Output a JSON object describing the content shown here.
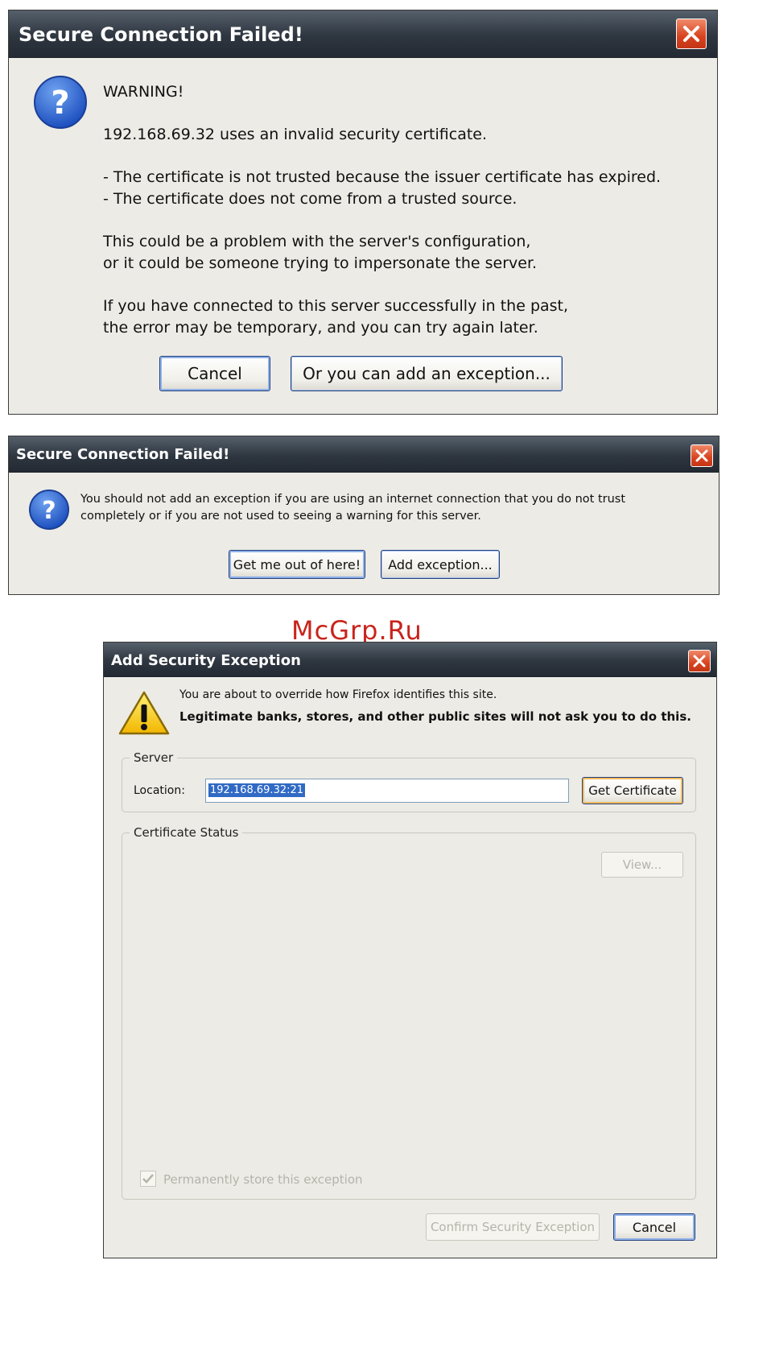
{
  "dialog1": {
    "title": "Secure Connection Failed!",
    "icon": "question-icon",
    "heading": "WARNING!",
    "line_host": "192.168.69.32 uses an invalid security certificate.",
    "bullet1": "- The certificate is not trusted because the issuer certificate has expired.",
    "bullet2": "- The certificate does not come from a trusted source.",
    "para2_line1": "This could be a problem with the server's configuration,",
    "para2_line2": "or it could be someone trying to impersonate the server.",
    "para3_line1": "If you have connected to this server successfully in the past,",
    "para3_line2": "the error may be temporary, and you can try again later.",
    "cancel_label": "Cancel",
    "exception_label": "Or you can add an exception..."
  },
  "dialog2": {
    "title": "Secure Connection Failed!",
    "icon": "question-icon",
    "line1": "You should not add an exception if you are using an internet connection that you do not trust",
    "line2": "completely or if you are not used to seeing a warning for this server.",
    "get_out_label": "Get me out of here!",
    "add_exception_label": "Add exception..."
  },
  "watermark": "McGrp.Ru",
  "dialog3": {
    "title": "Add Security Exception",
    "icon": "warning-icon",
    "line1": "You are about to override how Firefox identifies this site.",
    "line2": "Legitimate banks, stores, and other public sites will not ask you to do this.",
    "server_legend": "Server",
    "location_label": "Location:",
    "location_value": "192.168.69.32:21",
    "get_certificate_label": "Get Certificate",
    "status_legend": "Certificate Status",
    "view_label": "View...",
    "permanent_label": "Permanently store this exception",
    "permanent_checked": true,
    "confirm_label": "Confirm Security Exception",
    "cancel_label": "Cancel"
  },
  "colors": {
    "titlebar": "#2e3640",
    "close_button": "#d8431f",
    "dialog_bg": "#ecebe6",
    "button_border": "#23407a",
    "selection": "#316ac5",
    "watermark": "#c8241c"
  }
}
